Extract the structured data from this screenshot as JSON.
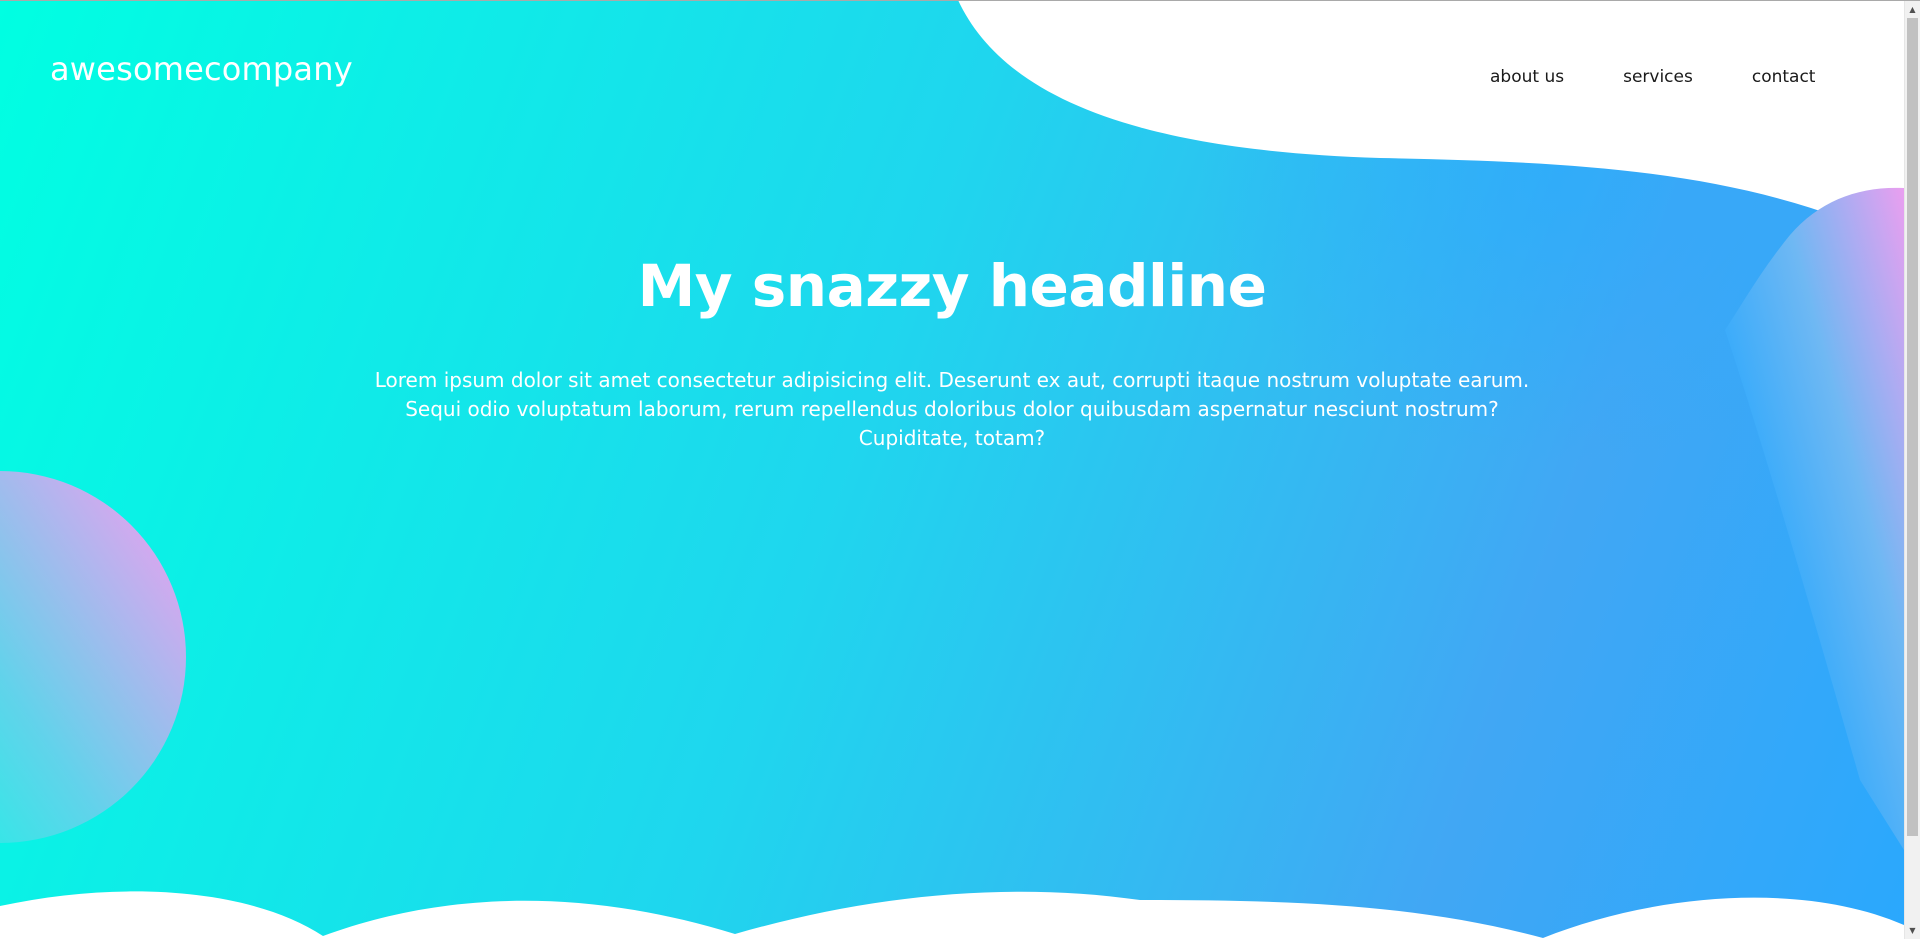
{
  "header": {
    "brand": "awesomecompany",
    "nav": [
      {
        "label": "about us"
      },
      {
        "label": "services"
      },
      {
        "label": "contact"
      }
    ]
  },
  "hero": {
    "headline": "My snazzy headline",
    "body": "Lorem ipsum dolor sit amet consectetur adipisicing elit. Deserunt ex aut, corrupti itaque nostrum voluptate earum. Sequi odio voluptatum laborum, rerum repellendus doloribus dolor quibusdam aspernatur nesciunt nostrum? Cupiditate, totam?"
  },
  "colors": {
    "gradient_start": "#00ffe2",
    "gradient_mid": "#1fd6ee",
    "gradient_end": "#2aa8fd",
    "blob_pink": "#e8a6f2",
    "text_light": "#ffffff",
    "nav_text": "#1a1a1a"
  },
  "icons": {
    "scroll_up": "scroll-up-arrow-icon",
    "scroll_down": "scroll-down-arrow-icon"
  }
}
